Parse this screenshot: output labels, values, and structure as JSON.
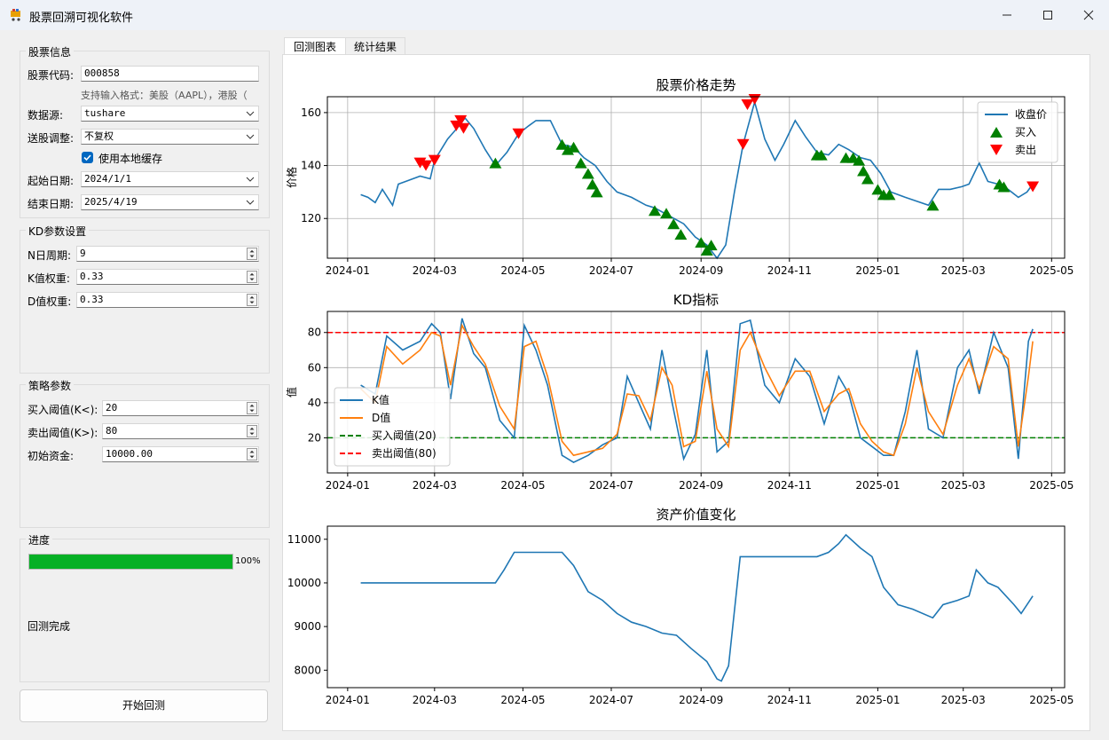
{
  "window": {
    "title": "股票回溯可视化软件",
    "minimize_label": "—",
    "close_label": "✕"
  },
  "stock_info": {
    "group_title": "股票信息",
    "code_label": "股票代码:",
    "code_value": "000858",
    "hint": "支持输入格式：美股（AAPL），港股（",
    "source_label": "数据源:",
    "source_value": "tushare",
    "adjust_label": "送股调整:",
    "adjust_value": "不复权",
    "cache_label": "使用本地缓存",
    "cache_checked": true,
    "start_label": "起始日期:",
    "start_value": "2024/1/1",
    "end_label": "结束日期:",
    "end_value": "2025/4/19"
  },
  "kd_params": {
    "group_title": "KD参数设置",
    "n_label": "N日周期:",
    "n_value": "9",
    "k_label": "K值权重:",
    "k_value": "0.33",
    "d_label": "D值权重:",
    "d_value": "0.33"
  },
  "strategy": {
    "group_title": "策略参数",
    "buy_label": "买入阈值(K<):",
    "buy_value": "20",
    "sell_label": "卖出阈值(K>):",
    "sell_value": "80",
    "capital_label": "初始资金:",
    "capital_value": "10000.00"
  },
  "progress": {
    "group_title": "进度",
    "percent": 100,
    "percent_label": "100%",
    "status": "回测完成"
  },
  "start_button": "开始回测",
  "tabs": [
    "回测图表",
    "统计结果"
  ],
  "colors": {
    "line": "#1f77b4",
    "d_line": "#ff7f0e",
    "buy": "#008000",
    "sell": "#ff0000",
    "progress": "#06b025",
    "accent": "#0067c0"
  },
  "x_ticks": [
    "2024-01",
    "2024-03",
    "2024-05",
    "2024-07",
    "2024-09",
    "2024-11",
    "2025-01",
    "2025-03",
    "2025-05"
  ],
  "chart_data": [
    {
      "type": "line",
      "title": "股票价格走势",
      "ylabel": "价格",
      "xlim": [
        "2023-12-18",
        "2025-05-10"
      ],
      "ylim": [
        105,
        166
      ],
      "yticks": [
        120,
        140,
        160
      ],
      "grid": true,
      "legend": "top-right",
      "legend_labels": [
        "收盘价",
        "买入",
        "卖出"
      ],
      "series": [
        {
          "name": "收盘价",
          "x": [
            "2024-01-10",
            "2024-01-15",
            "2024-01-20",
            "2024-01-25",
            "2024-02-01",
            "2024-02-05",
            "2024-02-10",
            "2024-02-20",
            "2024-02-27",
            "2024-03-01",
            "2024-03-10",
            "2024-03-18",
            "2024-03-22",
            "2024-03-28",
            "2024-04-05",
            "2024-04-12",
            "2024-04-20",
            "2024-04-28",
            "2024-05-05",
            "2024-05-10",
            "2024-05-20",
            "2024-05-28",
            "2024-06-05",
            "2024-06-12",
            "2024-06-20",
            "2024-06-28",
            "2024-07-05",
            "2024-07-15",
            "2024-07-25",
            "2024-07-31",
            "2024-08-10",
            "2024-08-20",
            "2024-08-28",
            "2024-09-05",
            "2024-09-12",
            "2024-09-18",
            "2024-09-24",
            "2024-09-30",
            "2024-10-08",
            "2024-10-15",
            "2024-10-22",
            "2024-10-28",
            "2024-11-05",
            "2024-11-12",
            "2024-11-20",
            "2024-11-28",
            "2024-12-05",
            "2024-12-12",
            "2024-12-20",
            "2024-12-27",
            "2025-01-03",
            "2025-01-10",
            "2025-01-20",
            "2025-02-05",
            "2025-02-12",
            "2025-02-20",
            "2025-02-28",
            "2025-03-05",
            "2025-03-12",
            "2025-03-18",
            "2025-03-25",
            "2025-04-01",
            "2025-04-08",
            "2025-04-14",
            "2025-04-18"
          ],
          "y": [
            129,
            128,
            126,
            131,
            125,
            133,
            134,
            136,
            135,
            142,
            150,
            155,
            158,
            154,
            146,
            140,
            145,
            152,
            155,
            157,
            157,
            148,
            147,
            143,
            140,
            134,
            130,
            128,
            125,
            124,
            121,
            118,
            113,
            110,
            105,
            110,
            130,
            148,
            164,
            150,
            142,
            148,
            157,
            151,
            145,
            144,
            148,
            146,
            143,
            142,
            137,
            130,
            128,
            125,
            131,
            131,
            132,
            133,
            141,
            134,
            133,
            131,
            128,
            130,
            133
          ]
        }
      ],
      "buy_signals": {
        "x": [
          "2024-04-12",
          "2024-05-28",
          "2024-06-01",
          "2024-06-05",
          "2024-06-10",
          "2024-06-15",
          "2024-06-18",
          "2024-06-21",
          "2024-07-31",
          "2024-08-08",
          "2024-08-13",
          "2024-08-18",
          "2024-09-01",
          "2024-09-05",
          "2024-09-08",
          "2024-11-20",
          "2024-11-23",
          "2024-12-10",
          "2024-12-15",
          "2024-12-19",
          "2024-12-22",
          "2024-12-25",
          "2025-01-01",
          "2025-01-05",
          "2025-01-09",
          "2025-02-08",
          "2025-03-26",
          "2025-03-29"
        ],
        "y": [
          141,
          148,
          146,
          147,
          141,
          137,
          133,
          130,
          123,
          122,
          118,
          114,
          111,
          108,
          110,
          144,
          144,
          143,
          143,
          142,
          138,
          135,
          131,
          129,
          129,
          125,
          133,
          132
        ]
      },
      "sell_signals": {
        "x": [
          "2024-02-20",
          "2024-02-24",
          "2024-03-01",
          "2024-03-16",
          "2024-03-19",
          "2024-03-21",
          "2024-04-28",
          "2024-09-30",
          "2024-10-03",
          "2024-10-08",
          "2025-04-18"
        ],
        "y": [
          141,
          140,
          142,
          155,
          157,
          154,
          152,
          148,
          163,
          165,
          132
        ]
      }
    },
    {
      "type": "line",
      "title": "KD指标",
      "ylabel": "值",
      "xlim": [
        "2023-12-18",
        "2025-05-10"
      ],
      "ylim": [
        0,
        92
      ],
      "yticks": [
        20,
        40,
        60,
        80
      ],
      "grid": true,
      "legend": "bottom-left",
      "legend_labels": [
        "K值",
        "D值",
        "买入阈值(20)",
        "卖出阈值(80)"
      ],
      "thresholds": {
        "buy": 20,
        "sell": 80
      },
      "series": [
        {
          "name": "K值",
          "x": [
            "2024-01-10",
            "2024-01-20",
            "2024-01-28",
            "2024-02-08",
            "2024-02-20",
            "2024-02-28",
            "2024-03-05",
            "2024-03-12",
            "2024-03-20",
            "2024-03-28",
            "2024-04-05",
            "2024-04-15",
            "2024-04-25",
            "2024-05-02",
            "2024-05-10",
            "2024-05-18",
            "2024-05-28",
            "2024-06-05",
            "2024-06-15",
            "2024-06-25",
            "2024-07-05",
            "2024-07-12",
            "2024-07-20",
            "2024-07-28",
            "2024-08-05",
            "2024-08-12",
            "2024-08-20",
            "2024-08-28",
            "2024-09-05",
            "2024-09-12",
            "2024-09-20",
            "2024-09-28",
            "2024-10-05",
            "2024-10-15",
            "2024-10-25",
            "2024-11-05",
            "2024-11-15",
            "2024-11-25",
            "2024-12-05",
            "2024-12-12",
            "2024-12-20",
            "2024-12-28",
            "2025-01-05",
            "2025-01-12",
            "2025-01-20",
            "2025-01-28",
            "2025-02-05",
            "2025-02-15",
            "2025-02-25",
            "2025-03-05",
            "2025-03-12",
            "2025-03-22",
            "2025-04-01",
            "2025-04-08",
            "2025-04-15",
            "2025-04-18"
          ],
          "y": [
            50,
            45,
            78,
            70,
            75,
            85,
            80,
            42,
            88,
            68,
            60,
            30,
            20,
            84,
            70,
            50,
            10,
            6,
            10,
            16,
            20,
            55,
            40,
            25,
            70,
            40,
            8,
            22,
            70,
            12,
            18,
            85,
            87,
            50,
            40,
            65,
            55,
            28,
            55,
            45,
            20,
            15,
            10,
            10,
            35,
            70,
            25,
            20,
            60,
            70,
            45,
            80,
            60,
            8,
            75,
            82
          ]
        },
        {
          "name": "D值",
          "x": [
            "2024-01-10",
            "2024-01-20",
            "2024-01-28",
            "2024-02-08",
            "2024-02-20",
            "2024-02-28",
            "2024-03-05",
            "2024-03-12",
            "2024-03-20",
            "2024-03-28",
            "2024-04-05",
            "2024-04-15",
            "2024-04-25",
            "2024-05-02",
            "2024-05-10",
            "2024-05-18",
            "2024-05-28",
            "2024-06-05",
            "2024-06-15",
            "2024-06-25",
            "2024-07-05",
            "2024-07-12",
            "2024-07-20",
            "2024-07-28",
            "2024-08-05",
            "2024-08-12",
            "2024-08-20",
            "2024-08-28",
            "2024-09-05",
            "2024-09-12",
            "2024-09-20",
            "2024-09-28",
            "2024-10-05",
            "2024-10-15",
            "2024-10-25",
            "2024-11-05",
            "2024-11-15",
            "2024-11-25",
            "2024-12-05",
            "2024-12-12",
            "2024-12-20",
            "2024-12-28",
            "2025-01-05",
            "2025-01-12",
            "2025-01-20",
            "2025-01-28",
            "2025-02-05",
            "2025-02-15",
            "2025-02-25",
            "2025-03-05",
            "2025-03-12",
            "2025-03-22",
            "2025-04-01",
            "2025-04-08",
            "2025-04-15",
            "2025-04-18"
          ],
          "y": [
            48,
            40,
            72,
            62,
            70,
            80,
            78,
            50,
            84,
            72,
            62,
            38,
            25,
            72,
            75,
            55,
            18,
            10,
            12,
            14,
            22,
            45,
            44,
            30,
            60,
            50,
            15,
            18,
            58,
            25,
            15,
            70,
            80,
            60,
            44,
            58,
            58,
            35,
            45,
            48,
            28,
            18,
            12,
            10,
            28,
            60,
            35,
            22,
            50,
            65,
            48,
            72,
            65,
            15,
            55,
            75
          ]
        }
      ]
    },
    {
      "type": "line",
      "title": "资产价值变化",
      "xlim": [
        "2023-12-18",
        "2025-05-10"
      ],
      "ylim": [
        7600,
        11300
      ],
      "yticks": [
        8000,
        9000,
        10000,
        11000
      ],
      "grid": false,
      "series": [
        {
          "x": [
            "2024-01-10",
            "2024-04-12",
            "2024-04-18",
            "2024-04-25",
            "2024-05-28",
            "2024-06-05",
            "2024-06-15",
            "2024-06-25",
            "2024-07-05",
            "2024-07-15",
            "2024-07-25",
            "2024-08-05",
            "2024-08-15",
            "2024-08-25",
            "2024-09-05",
            "2024-09-12",
            "2024-09-15",
            "2024-09-20",
            "2024-09-28",
            "2024-11-20",
            "2024-11-28",
            "2024-12-05",
            "2024-12-10",
            "2024-12-20",
            "2024-12-28",
            "2025-01-05",
            "2025-01-15",
            "2025-01-25",
            "2025-02-08",
            "2025-02-15",
            "2025-02-25",
            "2025-03-05",
            "2025-03-10",
            "2025-03-18",
            "2025-03-25",
            "2025-04-05",
            "2025-04-10",
            "2025-04-18"
          ],
          "y": [
            10000,
            10000,
            10300,
            10700,
            10700,
            10400,
            9800,
            9600,
            9300,
            9100,
            9000,
            8850,
            8800,
            8500,
            8200,
            7800,
            7750,
            8100,
            10600,
            10600,
            10700,
            10900,
            11100,
            10800,
            10600,
            9900,
            9500,
            9400,
            9200,
            9500,
            9600,
            9700,
            10300,
            10000,
            9900,
            9500,
            9300,
            9700
          ]
        }
      ]
    }
  ]
}
